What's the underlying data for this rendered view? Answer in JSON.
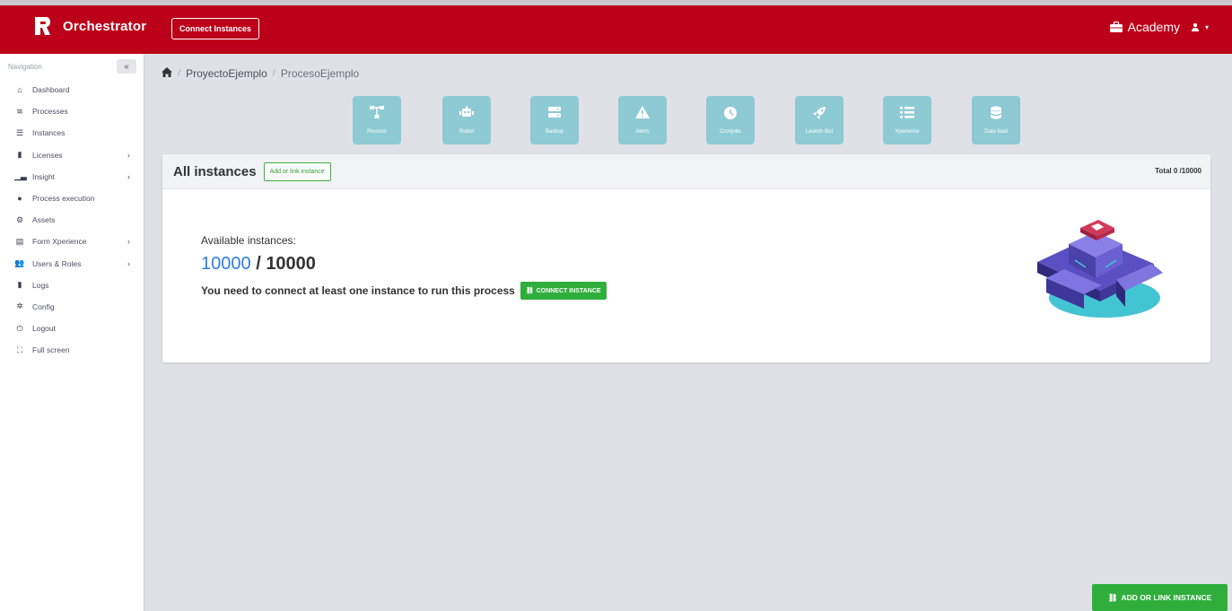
{
  "header": {
    "brand": "Orchestrator",
    "connect_instances_label": "Connect Instances",
    "user_label": "Academy"
  },
  "sidebar": {
    "title": "Navigation",
    "collapse_symbol": "«",
    "items": [
      {
        "label": "Dashboard",
        "icon": "home-icon",
        "chevron": false
      },
      {
        "label": "Processes",
        "icon": "layers-icon",
        "chevron": false
      },
      {
        "label": "Instances",
        "icon": "server-icon",
        "chevron": false
      },
      {
        "label": "Licenses",
        "icon": "file-icon",
        "chevron": true
      },
      {
        "label": "Insight",
        "icon": "chart-icon",
        "chevron": true
      },
      {
        "label": "Process execution",
        "icon": "clock-icon",
        "chevron": false
      },
      {
        "label": "Assets",
        "icon": "cogs-icon",
        "chevron": false
      },
      {
        "label": "Form Xperience",
        "icon": "form-icon",
        "chevron": true
      },
      {
        "label": "Users & Roles",
        "icon": "users-icon",
        "chevron": true
      },
      {
        "label": "Logs",
        "icon": "file-icon",
        "chevron": false
      },
      {
        "label": "Config",
        "icon": "gear-icon",
        "chevron": false
      },
      {
        "label": "Logout",
        "icon": "power-icon",
        "chevron": false
      },
      {
        "label": "Full screen",
        "icon": "expand-icon",
        "chevron": false
      }
    ]
  },
  "breadcrumb": {
    "project": "ProyectoEjemplo",
    "process": "ProcesoEjemplo"
  },
  "tools": [
    {
      "label": "Process",
      "icon": "sitemap-icon"
    },
    {
      "label": "Robot",
      "icon": "robot-icon"
    },
    {
      "label": "Backup",
      "icon": "server-icon"
    },
    {
      "label": "Alerts",
      "icon": "warning-icon"
    },
    {
      "label": "Cronjobs",
      "icon": "clock-icon"
    },
    {
      "label": "Launch Bot",
      "icon": "rocket-icon"
    },
    {
      "label": "Xperience",
      "icon": "list-icon"
    },
    {
      "label": "Data load",
      "icon": "database-icon"
    }
  ],
  "panel": {
    "title": "All instances",
    "add_link_label": "Add or link instance",
    "total": "Total 0 /10000",
    "available_label": "Available instances:",
    "available_current": "10000",
    "available_separator": "/",
    "available_max": "10000",
    "need_text": "You need to connect at least one instance to run this process",
    "connect_label": "CONNECT INSTANCE"
  },
  "float_button": {
    "label": "ADD OR LINK INSTANCE"
  },
  "colors": {
    "header": "#bc0019",
    "tool_tile": "#8ecad4",
    "success": "#2fae3c",
    "link_blue": "#2e7fe0",
    "background": "#dfe1e6"
  }
}
